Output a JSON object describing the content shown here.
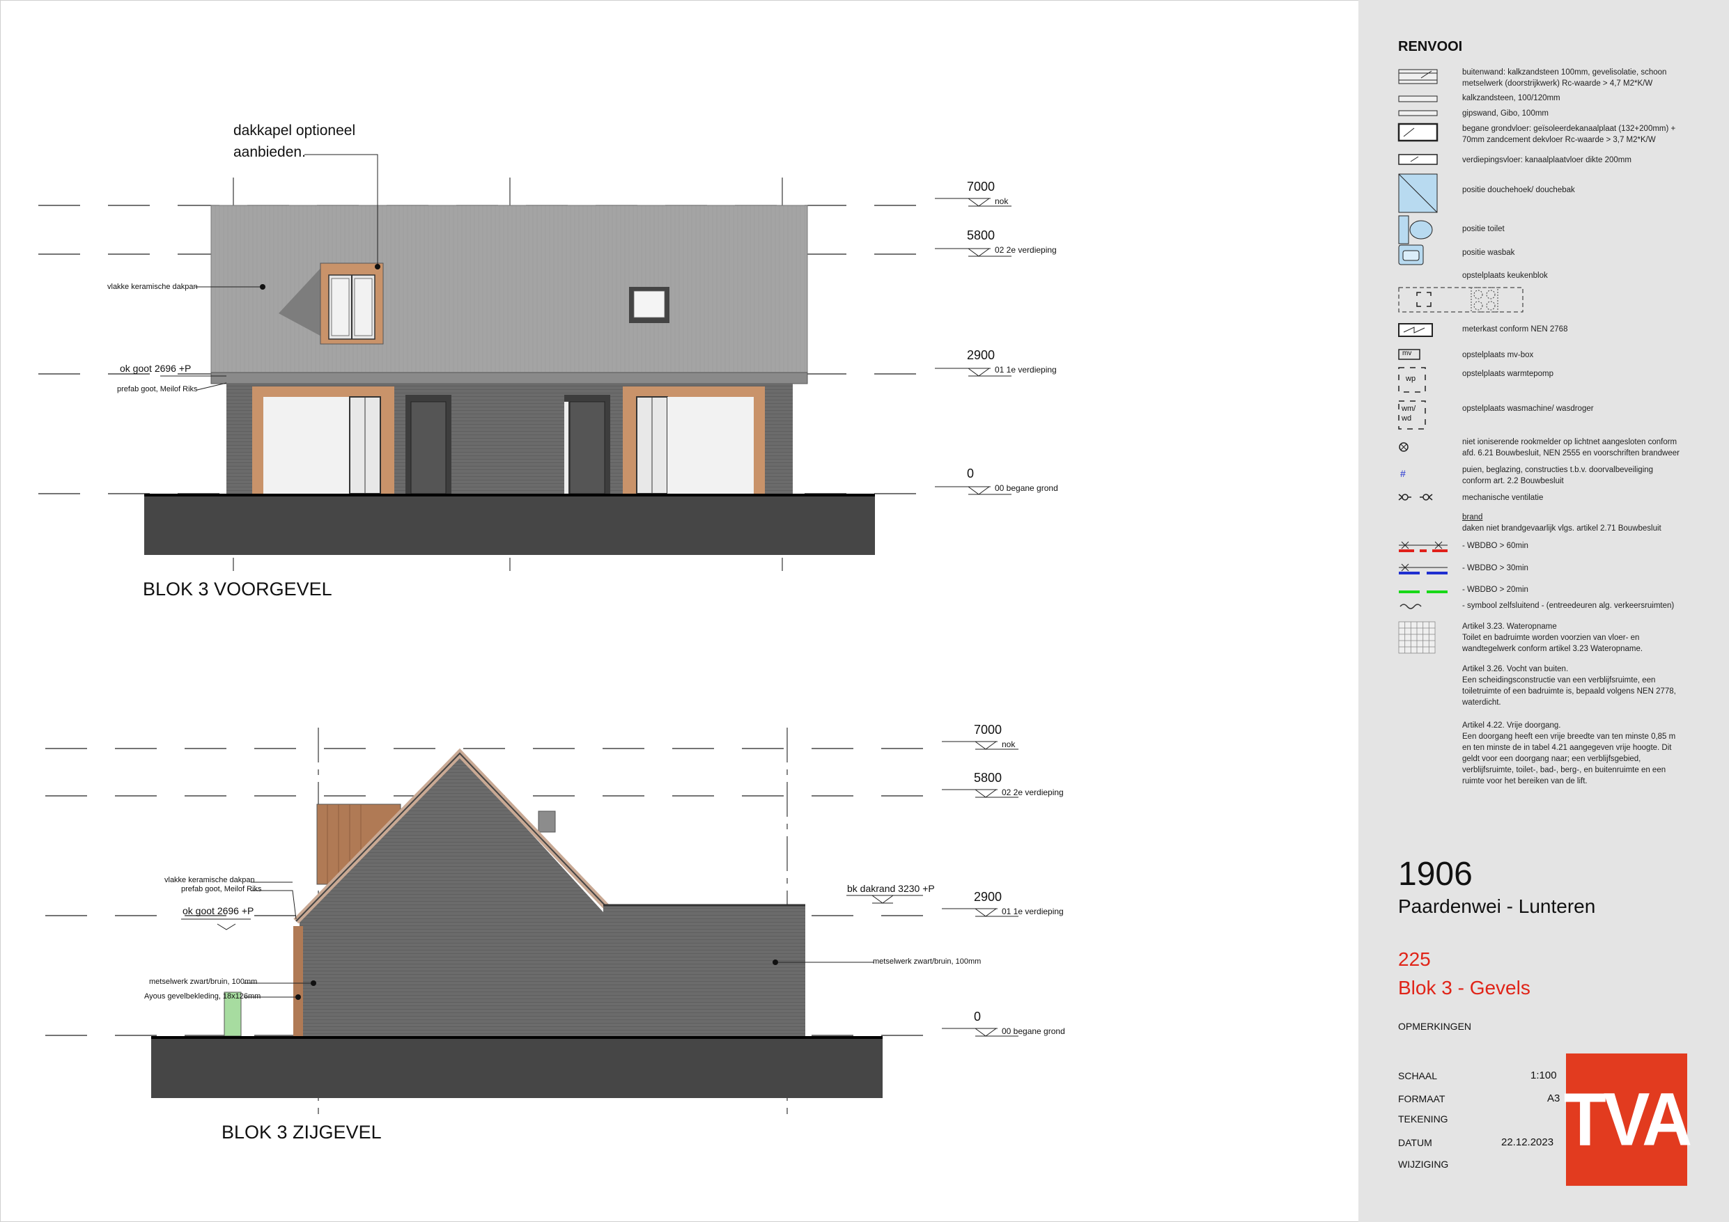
{
  "elevations": {
    "front": {
      "title": "BLOK 3 VOORGEVEL",
      "note_dormer": [
        "dakkapel optioneel",
        "aanbieden."
      ],
      "label_roof": "vlakke keramische dakpan",
      "label_gutter_level": "ok goot 2696 +P",
      "label_gutter": "prefab goot, Meilof Riks",
      "levels": [
        {
          "value": "7000",
          "name": "nok"
        },
        {
          "value": "5800",
          "name": "02 2e verdieping"
        },
        {
          "value": "2900",
          "name": "01 1e verdieping"
        },
        {
          "value": "0",
          "name": "00 begane grond"
        }
      ]
    },
    "side": {
      "title": "BLOK 3 ZIJGEVEL",
      "label_roof": "vlakke keramische dakpan",
      "label_gutter": "prefab goot, Meilof Riks",
      "label_gutter_level": "ok goot 2696 +P",
      "label_brick": "metselwerk zwart/bruin, 100mm",
      "label_cladding": "Ayous gevelbekleding, 18x126mm",
      "label_dakrand": "bk dakrand 3230 +P",
      "label_brick_right": "metselwerk zwart/bruin, 100mm",
      "levels": [
        {
          "value": "7000",
          "name": "nok"
        },
        {
          "value": "5800",
          "name": "02 2e verdieping"
        },
        {
          "value": "2900",
          "name": "01 1e verdieping"
        },
        {
          "value": "0",
          "name": "00 begane grond"
        }
      ]
    }
  },
  "legend": {
    "heading": "RENVOOI",
    "items": [
      {
        "icon": "wall-hatch-icon",
        "text": [
          "buitenwand: kalkzandsteen 100mm, gevelisolatie, schoon",
          "metselwerk (doorstrijkwerk) Rc-waarde > 4,7 M2*K/W"
        ]
      },
      {
        "icon": "sand-lime-wall-icon",
        "text": [
          "kalkzandsteen, 100/120mm"
        ]
      },
      {
        "icon": "gypsum-wall-icon",
        "text": [
          "gipswand, Gibo, 100mm"
        ]
      },
      {
        "icon": "ground-floor-icon",
        "text": [
          "begane grondvloer: geïsoleerdekanaalplaat (132+200mm) +",
          "70mm zandcement dekvloer Rc-waarde > 3,7 M2*K/W"
        ]
      },
      {
        "icon": "floor-slab-icon",
        "text": [
          "verdiepingsvloer: kanaalplaatvloer dikte 200mm"
        ]
      },
      {
        "icon": "shower-icon",
        "text": [
          "positie douchehoek/ douchebak"
        ]
      },
      {
        "icon": "toilet-icon",
        "text": [
          "positie toilet"
        ]
      },
      {
        "icon": "sink-icon",
        "text": [
          "positie wasbak"
        ]
      },
      {
        "icon": "kitchen-icon",
        "text": [
          "opstelplaats keukenblok"
        ]
      },
      {
        "icon": "meter-box-icon",
        "text": [
          "meterkast conform NEN 2768"
        ]
      },
      {
        "icon": "mv-box-icon",
        "text": [
          "opstelplaats mv-box"
        ],
        "tag": "mv"
      },
      {
        "icon": "heat-pump-icon",
        "text": [
          "opstelplaats warmtepomp"
        ],
        "tag": "wp"
      },
      {
        "icon": "washer-icon",
        "text": [
          "opstelplaats wasmachine/ wasdroger"
        ],
        "tag": "wm/ wd"
      },
      {
        "icon": "smoke-detector-icon",
        "text": [
          "niet ioniserende rookmelder op lichtnet aangesloten conform",
          "afd. 6.21 Bouwbesluit, NEN 2555 en voorschriften brandweer"
        ]
      },
      {
        "icon": "fall-protection-icon",
        "text": [
          "puien, beglazing, constructies t.b.v. doorvalbeveiliging",
          "conform art. 2.2 Bouwbesluit"
        ],
        "tag": "#"
      },
      {
        "icon": "ventilation-icon",
        "text": [
          "mechanische ventilatie"
        ]
      }
    ],
    "fire": {
      "heading": "brand",
      "subheading": "daken niet brandgevaarlijk vlgs. artikel 2.71 Bouwbesluit",
      "items": [
        {
          "text": "- WBDBO > 60min",
          "color": "#e0201a"
        },
        {
          "text": "- WBDBO > 30min",
          "color": "#1f2fd0"
        },
        {
          "text": "- WBDBO > 20min",
          "color": "#18d818"
        },
        {
          "text": "- symbool zelfsluitend - (entreedeuren alg. verkeersruimten)",
          "color": "#333333"
        }
      ]
    },
    "articles": [
      [
        "Artikel 3.23. Wateropname",
        "Toilet en badruimte worden voorzien van vloer- en",
        "wandtegelwerk conform artikel 3.23 Wateropname."
      ],
      [
        "Artikel 3.26. Vocht van buiten.",
        "Een scheidingsconstructie van een verblijfsruimte, een",
        "toiletruimte of een badruimte is, bepaald volgens NEN 2778,",
        "waterdicht."
      ],
      [
        "Artikel 4.22. Vrije doorgang.",
        "Een doorgang heeft een vrije breedte van ten minste 0,85 m",
        "en ten minste de in tabel 4.21 aangegeven vrije hoogte. Dit",
        "geldt voor een doorgang naar; een verblijfsgebied,",
        "verblijfsruimte, toilet-, bad-, berg-, en buitenruimte en een",
        "ruimte voor het bereiken van de lift."
      ]
    ]
  },
  "titleblock": {
    "project_number": "1906",
    "project_name": "Paardenwei - Lunteren",
    "sheet_number": "225",
    "sheet_title": "Blok 3 - Gevels",
    "remarks_label": "OPMERKINGEN",
    "fields": [
      {
        "key": "SCHAAL",
        "value": "1:100"
      },
      {
        "key": "FORMAAT",
        "value": "A3"
      },
      {
        "key": "TEKENING",
        "value": ""
      },
      {
        "key": "DATUM",
        "value": "22.12.2023"
      },
      {
        "key": "WIJZIGING",
        "value": ""
      }
    ],
    "logo": "TVA"
  },
  "colors": {
    "roof": "#a3a3a3",
    "brick": "#6d6d6d",
    "ground": "#464646",
    "wood": "#c9936a",
    "accent": "#e23b1f"
  }
}
